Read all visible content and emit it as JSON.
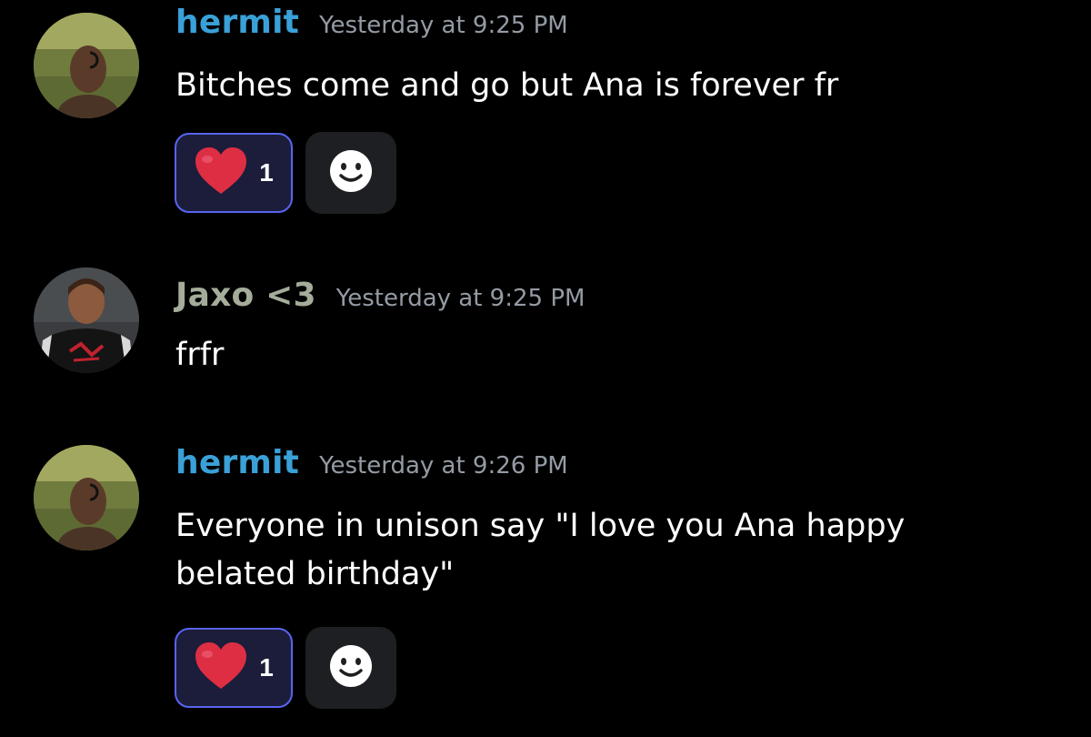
{
  "colors": {
    "background": "#000000",
    "hermit_name": "#3aa0d8",
    "jaxo_name": "#a3ad9a",
    "timestamp": "#949ba4",
    "reaction_border": "#5865f2",
    "reaction_bg": "#1b1d3a",
    "add_reaction_bg": "#1e1f22"
  },
  "messages": [
    {
      "author": "hermit",
      "timestamp": "Yesterday at 9:25 PM",
      "lines": [
        "Bitches come and go but Ana is forever fr"
      ],
      "reaction": {
        "emoji": "heart-icon",
        "count": "1"
      }
    },
    {
      "author": "Jaxo <3",
      "timestamp": "Yesterday at 9:25 PM",
      "lines": [
        "frfr"
      ]
    },
    {
      "author": "hermit",
      "timestamp": "Yesterday at 9:26 PM",
      "lines": [
        "Everyone in unison say \"I love you Ana happy",
        "belated birthday\""
      ],
      "reaction": {
        "emoji": "heart-icon",
        "count": "1"
      }
    }
  ]
}
